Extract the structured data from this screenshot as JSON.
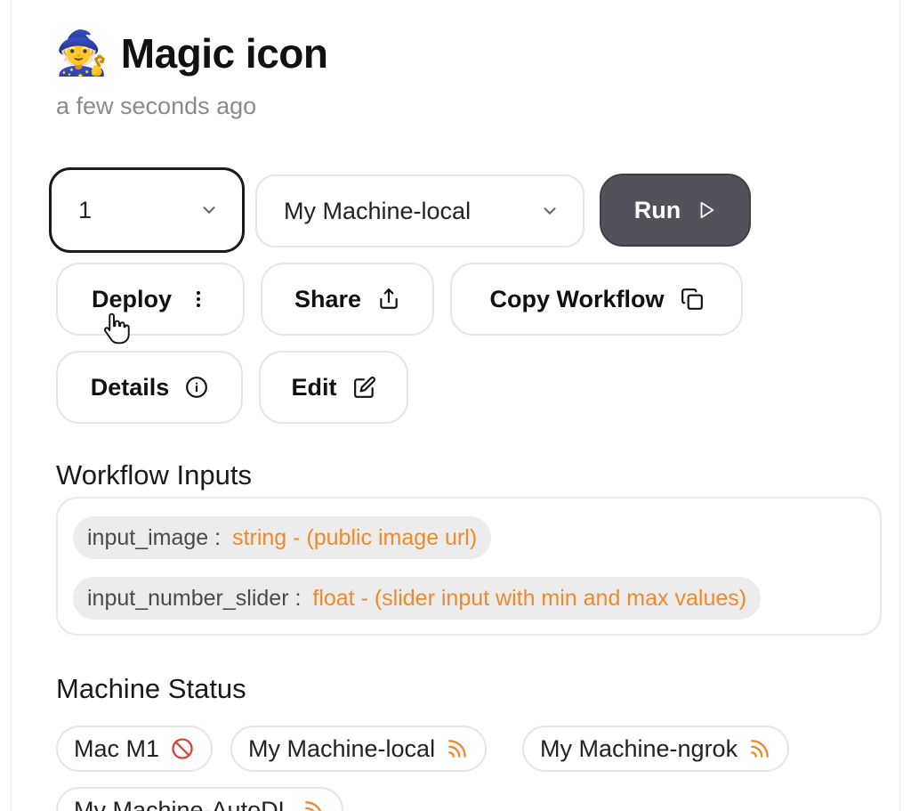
{
  "header": {
    "icon": "mage-emoji",
    "title": "Magic icon",
    "subtitle": "a few seconds ago"
  },
  "controls": {
    "version_select": {
      "value": "1",
      "icon": "chevron-down-icon"
    },
    "machine_select": {
      "value": "My Machine-local",
      "icon": "chevron-down-icon"
    },
    "run_button": {
      "label": "Run",
      "icon": "play-icon",
      "color": "#52525b"
    },
    "deploy_button": {
      "label": "Deploy",
      "icon": "more-vertical-icon"
    },
    "share_button": {
      "label": "Share",
      "icon": "share-icon"
    },
    "copy_button": {
      "label": "Copy Workflow",
      "icon": "copy-icon"
    },
    "details_button": {
      "label": "Details",
      "icon": "info-icon"
    },
    "edit_button": {
      "label": "Edit",
      "icon": "edit-icon"
    }
  },
  "workflow_inputs": {
    "title": "Workflow Inputs",
    "items": [
      {
        "name": "input_image",
        "sep": " : ",
        "type": "string - (public image url)"
      },
      {
        "name": "input_number_slider",
        "sep": " : ",
        "type": "float - (slider input with min and max values)"
      }
    ],
    "type_color": "#ee8a2b"
  },
  "machine_status": {
    "title": "Machine Status",
    "machines": [
      {
        "name": "Mac M1",
        "icon": "offline-icon",
        "icon_color": "#e0403a"
      },
      {
        "name": "My Machine-local",
        "icon": "signal-icon",
        "icon_color": "#ee8a2b"
      },
      {
        "name": "My Machine-ngrok",
        "icon": "signal-icon",
        "icon_color": "#ee8a2b"
      },
      {
        "name": "My Machine-AutoDL",
        "icon": "signal-icon",
        "icon_color": "#ee8a2b"
      }
    ]
  }
}
